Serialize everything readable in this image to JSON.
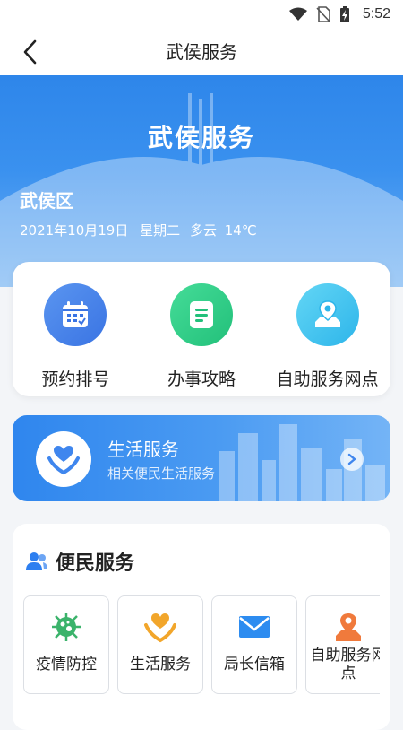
{
  "status_bar": {
    "time": "5:52"
  },
  "nav": {
    "title": "武侯服务"
  },
  "hero": {
    "title": "武侯服务",
    "district": "武侯区",
    "date": "2021年10月19日",
    "weekday": "星期二",
    "weather": "多云",
    "temperature": "14℃"
  },
  "quick_actions": [
    {
      "label": "预约排号",
      "icon": "calendar-icon",
      "color": "#3f7fe9"
    },
    {
      "label": "办事攻略",
      "icon": "document-icon",
      "color": "#2fcf8a"
    },
    {
      "label": "自助服务网点",
      "icon": "location-map-icon",
      "color": "#3cc6f0"
    }
  ],
  "life_banner": {
    "title": "生活服务",
    "subtitle": "相关便民生活服务",
    "icon": "heart-hands-icon"
  },
  "convenience": {
    "title": "便民服务",
    "items": [
      {
        "label": "疫情防控",
        "icon": "virus-icon",
        "color": "#3bb36b"
      },
      {
        "label": "生活服务",
        "icon": "heart-hands-icon",
        "color": "#f2a62b"
      },
      {
        "label": "局长信箱",
        "icon": "mail-icon",
        "color": "#2d8cf0"
      },
      {
        "label": "自助服务网点",
        "icon": "location-map-icon",
        "color": "#f07a3c"
      }
    ]
  }
}
